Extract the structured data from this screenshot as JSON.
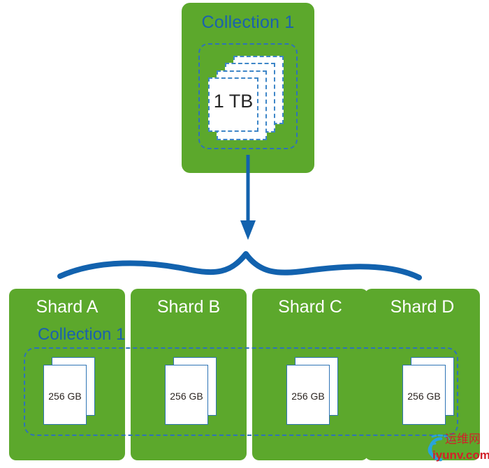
{
  "diagram": {
    "title_text": "Collection 1",
    "type": "sharding-diagram",
    "colors": {
      "green_box": "#5CA82C",
      "blue_text": "#1A61AE",
      "blue_line": "#1262AE",
      "dashed_border": "#2F72B8",
      "page_border": "#2E74B5",
      "white_text": "#FFFFFF",
      "watermark_red": "#D2202A",
      "watermark_blue": "#29A3DC"
    },
    "source": {
      "label": "Collection 1",
      "data_size": "1 TB",
      "page_count": 4
    },
    "arrow": {
      "direction": "down",
      "brace": "curly-brace-split"
    },
    "shards": [
      {
        "title": "Shard A",
        "data_size": "256 GB",
        "page_count": 2
      },
      {
        "title": "Shard B",
        "data_size": "256 GB",
        "page_count": 2
      },
      {
        "title": "Shard C",
        "data_size": "256 GB",
        "page_count": 2
      },
      {
        "title": "Shard D",
        "data_size": "256 GB",
        "page_count": 2
      }
    ],
    "shard_collection_label": "Collection 1"
  },
  "watermark": {
    "cn_text": "运维网",
    "domain_text": "iyunv.com",
    "logo_icon": "swoosh-circle-icon"
  }
}
